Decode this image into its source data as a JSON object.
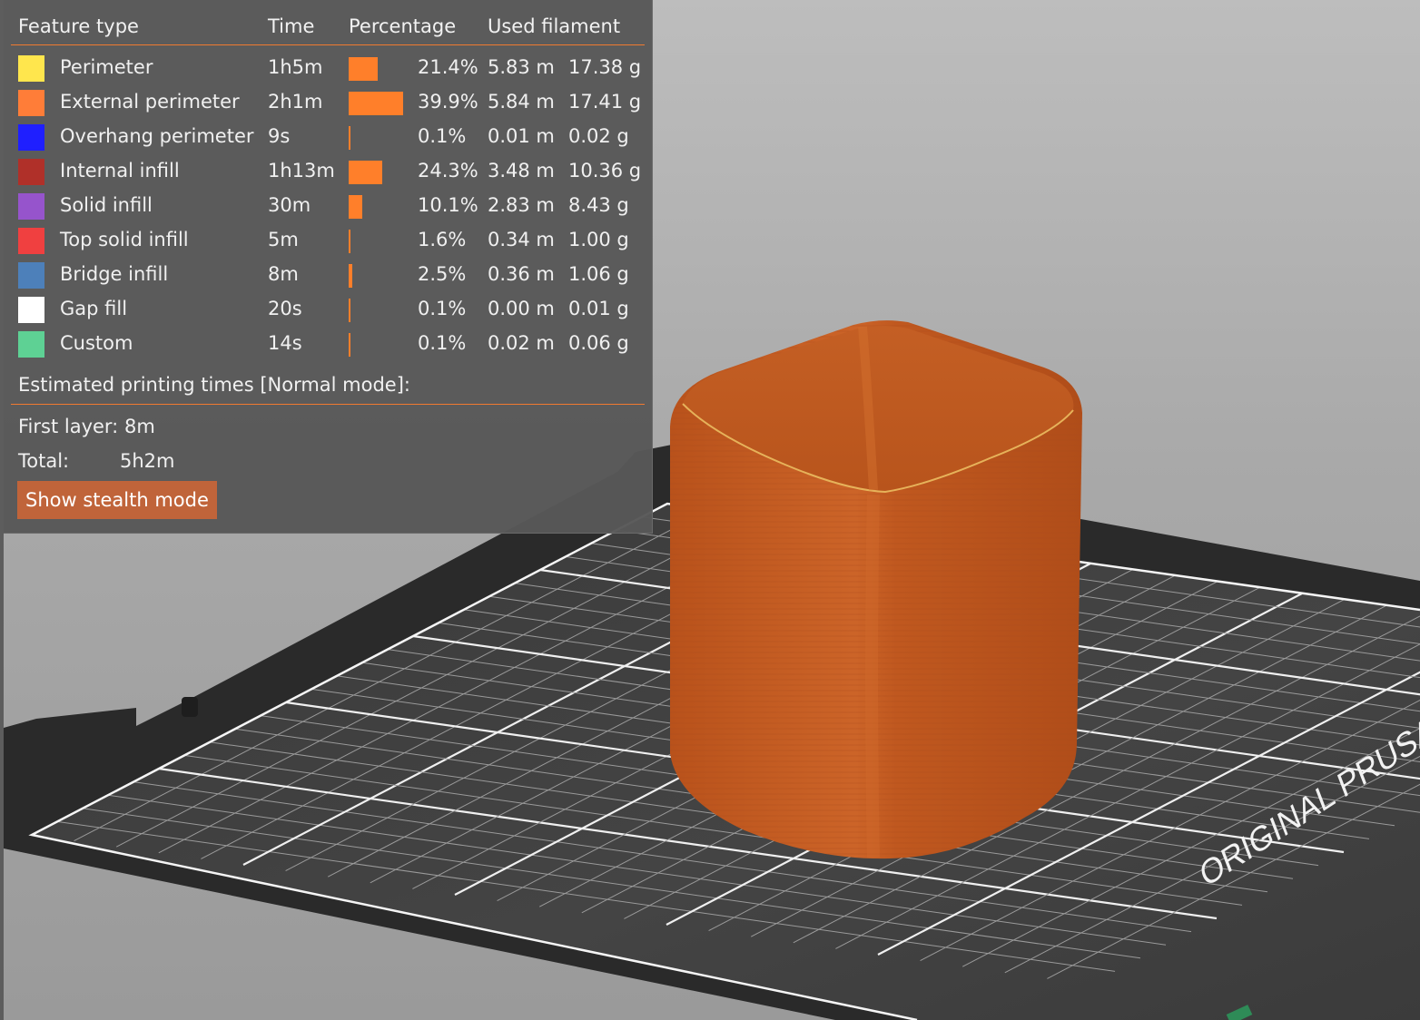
{
  "legend": {
    "headers": {
      "feature_type": "Feature type",
      "time": "Time",
      "percentage": "Percentage",
      "used_filament": "Used filament"
    },
    "rows": [
      {
        "name": "Perimeter",
        "color": "#FFE64D",
        "time": "1h5m",
        "percent": 21.4,
        "percent_label": "21.4%",
        "length": "5.83 m",
        "weight": "17.38 g"
      },
      {
        "name": "External perimeter",
        "color": "#FF7D38",
        "time": "2h1m",
        "percent": 39.9,
        "percent_label": "39.9%",
        "length": "5.84 m",
        "weight": "17.41 g"
      },
      {
        "name": "Overhang perimeter",
        "color": "#1F1FFF",
        "time": "9s",
        "percent": 0.1,
        "percent_label": "0.1%",
        "length": "0.01 m",
        "weight": "0.02 g"
      },
      {
        "name": "Internal infill",
        "color": "#B03029",
        "time": "1h13m",
        "percent": 24.3,
        "percent_label": "24.3%",
        "length": "3.48 m",
        "weight": "10.36 g"
      },
      {
        "name": "Solid infill",
        "color": "#9654CC",
        "time": "30m",
        "percent": 10.1,
        "percent_label": "10.1%",
        "length": "2.83 m",
        "weight": "8.43 g"
      },
      {
        "name": "Top solid infill",
        "color": "#F04040",
        "time": "5m",
        "percent": 1.6,
        "percent_label": "1.6%",
        "length": "0.34 m",
        "weight": "1.00 g"
      },
      {
        "name": "Bridge infill",
        "color": "#4D80BA",
        "time": "8m",
        "percent": 2.5,
        "percent_label": "2.5%",
        "length": "0.36 m",
        "weight": "1.06 g"
      },
      {
        "name": "Gap fill",
        "color": "#FFFFFF",
        "time": "20s",
        "percent": 0.1,
        "percent_label": "0.1%",
        "length": "0.00 m",
        "weight": "0.01 g"
      },
      {
        "name": "Custom",
        "color": "#5ED194",
        "time": "14s",
        "percent": 0.1,
        "percent_label": "0.1%",
        "length": "0.02 m",
        "weight": "0.06 g"
      }
    ],
    "bar_color": "#FF7F2A"
  },
  "estimates": {
    "title": "Estimated printing times [Normal mode]:",
    "first_layer_label": "First layer:",
    "first_layer_value": "8m",
    "total_label": "Total:",
    "total_value": "5h2m",
    "stealth_button": "Show stealth mode"
  },
  "scene": {
    "bed_label": "ORIGINAL PRUSA",
    "model_color": "#C0561E"
  }
}
